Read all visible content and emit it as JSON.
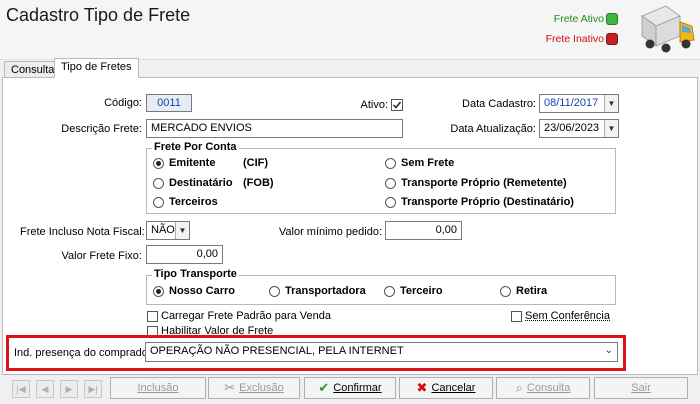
{
  "header": {
    "title": "Cadastro Tipo de Frete",
    "legend": [
      {
        "label": "Frete Ativo",
        "color": "#1a8a1a",
        "dot": "#3cb83c"
      },
      {
        "label": "Frete Inativo",
        "color": "#d01010",
        "dot": "#c42020"
      }
    ],
    "truck_icon": "truck-icon"
  },
  "tabs": [
    {
      "label": "Consulta",
      "active": false
    },
    {
      "label": "Tipo de Fretes",
      "active": true
    }
  ],
  "form": {
    "codigo_label": "Código:",
    "codigo_value": "0011",
    "ativo_label": "Ativo:",
    "ativo_checked": true,
    "data_cadastro_label": "Data Cadastro:",
    "data_cadastro_value": "08/11/2017",
    "descricao_label": "Descrição Frete:",
    "descricao_value": "MERCADO ENVIOS",
    "data_atualizacao_label": "Data Atualização:",
    "data_atualizacao_value": "23/06/2023",
    "frete_por_conta": {
      "title": "Frete Por Conta",
      "options": [
        {
          "label": "Emitente",
          "code": "(CIF)",
          "checked": true
        },
        {
          "label": "Destinatário",
          "code": "(FOB)",
          "checked": false
        },
        {
          "label": "Terceiros",
          "code": "",
          "checked": false
        },
        {
          "label": "Sem Frete",
          "code": "",
          "checked": false
        },
        {
          "label": "Transporte Próprio (Remetente)",
          "code": "",
          "checked": false
        },
        {
          "label": "Transporte Próprio (Destinatário)",
          "code": "",
          "checked": false
        }
      ]
    },
    "frete_incluso_label": "Frete Incluso Nota Fiscal:",
    "frete_incluso_value": "NÃO",
    "valor_minimo_label": "Valor mínimo pedido:",
    "valor_minimo_value": "0,00",
    "valor_frete_fixo_label": "Valor Frete Fixo:",
    "valor_frete_fixo_value": "0,00",
    "tipo_transporte": {
      "title": "Tipo Transporte",
      "options": [
        {
          "label": "Nosso Carro",
          "checked": true
        },
        {
          "label": "Transportadora",
          "checked": false
        },
        {
          "label": "Terceiro",
          "checked": false
        },
        {
          "label": "Retira",
          "checked": false
        }
      ]
    },
    "carregar_frete_label": "Carregar Frete Padrão para Venda",
    "carregar_frete_checked": false,
    "sem_conferencia_label": "Sem Conferência",
    "sem_conferencia_checked": false,
    "habilitar_valor_label": "Habilitar Valor de Frete",
    "habilitar_valor_checked": false,
    "ind_presenca_label": "Ind. presença do comprador:",
    "ind_presenca_value": "OPERAÇÃO NÃO PRESENCIAL, PELA INTERNET"
  },
  "toolbar": {
    "nav_icons": [
      "first-icon",
      "prev-icon",
      "next-icon",
      "last-icon"
    ],
    "buttons": [
      {
        "label": "Inclusão",
        "enabled": false,
        "icon": "",
        "icon_color": "#9a9a9a"
      },
      {
        "label": "Exclusão",
        "enabled": false,
        "icon": "✂",
        "icon_color": "#9a9a9a"
      },
      {
        "label": "Confirmar",
        "enabled": true,
        "icon": "✔",
        "icon_color": "#1e9e1e"
      },
      {
        "label": "Cancelar",
        "enabled": true,
        "icon": "✖",
        "icon_color": "#d01010"
      },
      {
        "label": "Consulta",
        "enabled": false,
        "icon": "⌕",
        "icon_color": "#9a9a9a"
      },
      {
        "label": "Sair",
        "enabled": false,
        "icon": "",
        "icon_color": "#9a9a9a"
      }
    ]
  }
}
